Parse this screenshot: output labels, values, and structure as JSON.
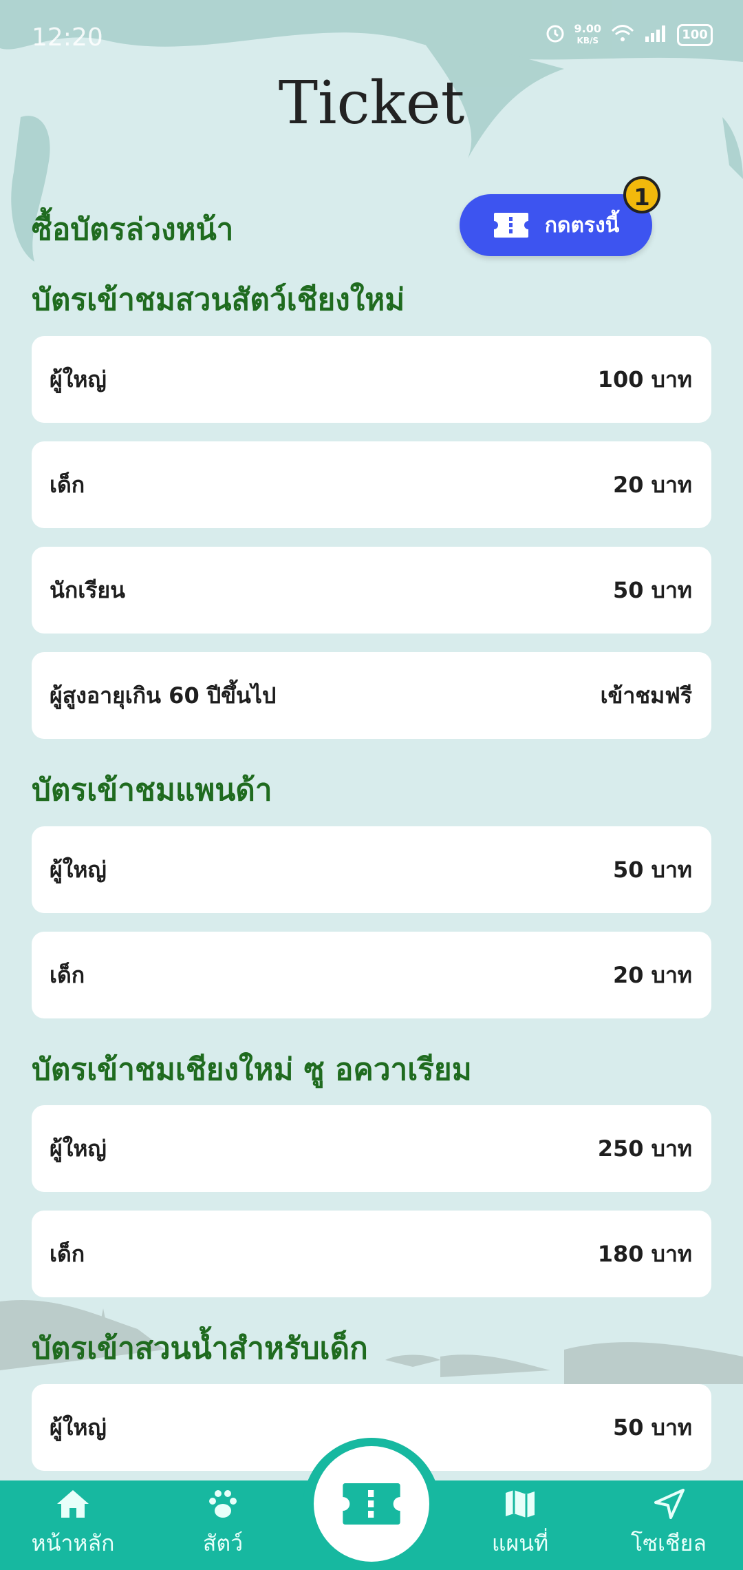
{
  "status_bar": {
    "time": "12:20",
    "speed": "9.00",
    "speed_unit": "KB/S",
    "battery": "100"
  },
  "title": "Ticket",
  "prebook": {
    "label": "ซื้อบัตรล่วงหน้า",
    "button_label": "กดตรงนี้",
    "badge": "1"
  },
  "sections": [
    {
      "title": "บัตรเข้าชมสวนสัตว์เชียงใหม่",
      "items": [
        {
          "label": "ผู้ใหญ่",
          "price": "100 บาท"
        },
        {
          "label": "เด็ก",
          "price": "20 บาท"
        },
        {
          "label": "นักเรียน",
          "price": "50 บาท"
        },
        {
          "label": "ผู้สูงอายุเกิน 60 ปีขึ้นไป",
          "price": "เข้าชมฟรี"
        }
      ]
    },
    {
      "title": "บัตรเข้าชมแพนด้า",
      "items": [
        {
          "label": "ผู้ใหญ่",
          "price": "50 บาท"
        },
        {
          "label": "เด็ก",
          "price": "20 บาท"
        }
      ]
    },
    {
      "title": "บัตรเข้าชมเชียงใหม่ ซู อควาเรียม",
      "items": [
        {
          "label": "ผู้ใหญ่",
          "price": "250 บาท"
        },
        {
          "label": "เด็ก",
          "price": "180 บาท"
        }
      ]
    },
    {
      "title": "บัตรเข้าสวนน้ำสำหรับเด็ก",
      "items": [
        {
          "label": "ผู้ใหญ่",
          "price": "50 บาท"
        }
      ]
    }
  ],
  "nav": {
    "home": "หน้าหลัก",
    "animals": "สัตว์",
    "map": "แผนที่",
    "social": "โซเชียล"
  },
  "colors": {
    "background": "#d8ecec",
    "heading_green": "#1f6b1f",
    "button_blue": "#3d54f0",
    "badge_yellow": "#f2b90c",
    "nav_teal": "#17b8a0"
  }
}
